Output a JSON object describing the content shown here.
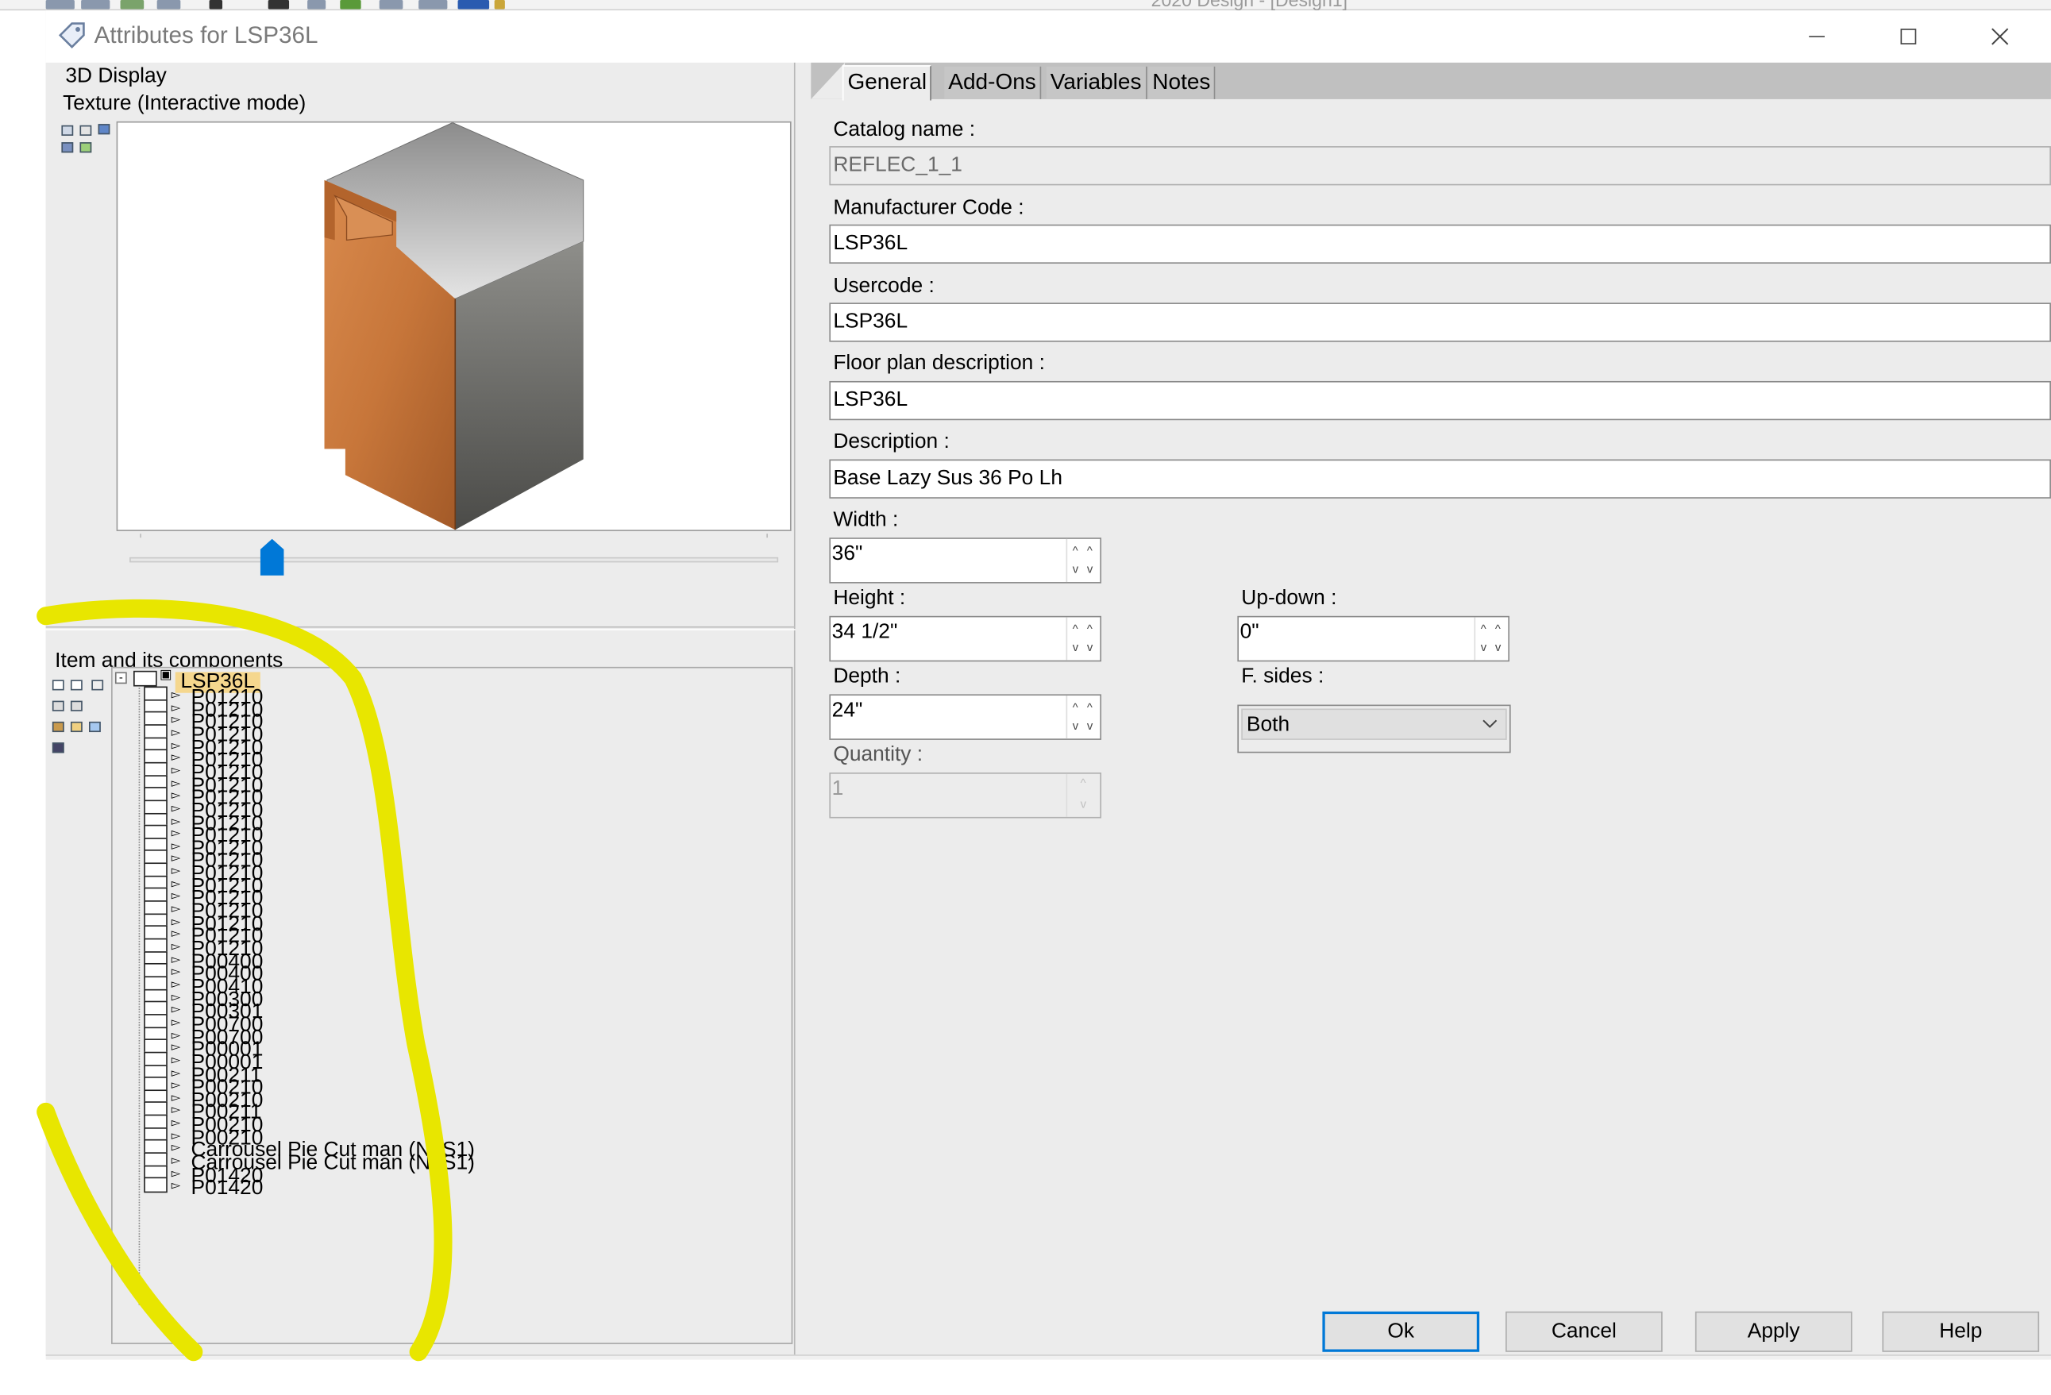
{
  "background_app": {
    "title": "2020 Design - [Design1]"
  },
  "window": {
    "title": "Attributes for LSP36L",
    "minimize": "—",
    "maximize": "☐",
    "close": "✕"
  },
  "left": {
    "display_label": "3D Display",
    "texture_label": "Texture (Interactive mode)",
    "components_label": "Item and its components",
    "tree": {
      "root": "LSP36L",
      "items": [
        "P01210",
        "P01210",
        "P01210",
        "P01210",
        "P01210",
        "P01210",
        "P01210",
        "P01210",
        "P01210",
        "P01210",
        "P01210",
        "P01210",
        "P01210",
        "P01210",
        "P01210",
        "P01210",
        "P01210",
        "P01210",
        "P01210",
        "P01210",
        "P01210",
        "P00400",
        "P00400",
        "P00410",
        "P00300",
        "P00301",
        "P00700",
        "P00700",
        "P00001",
        "P00001",
        "P00211",
        "P00210",
        "P00210",
        "P00211",
        "P00210",
        "P00210",
        "Carrousel Pie Cut man (NLS1)",
        "Carrousel Pie Cut man (NLS1)",
        "P01420",
        "P01420"
      ]
    }
  },
  "tabs": [
    "General",
    "Add-Ons",
    "Variables",
    "Notes"
  ],
  "form": {
    "catalog_name": {
      "label": "Catalog name :",
      "value": "REFLEC_1_1"
    },
    "manufacturer_code": {
      "label": "Manufacturer Code :",
      "value": "LSP36L"
    },
    "usercode": {
      "label": "Usercode :",
      "value": "LSP36L"
    },
    "floor_plan_description": {
      "label": "Floor plan description :",
      "value": "LSP36L"
    },
    "description": {
      "label": "Description :",
      "value": "Base Lazy Sus 36 Po Lh"
    },
    "width": {
      "label": "Width :",
      "value": "36\""
    },
    "height": {
      "label": "Height :",
      "value": "34 1/2\""
    },
    "depth": {
      "label": "Depth :",
      "value": "24\""
    },
    "quantity": {
      "label": "Quantity :",
      "value": "1"
    },
    "up_down": {
      "label": "Up-down :",
      "value": "0\""
    },
    "f_sides": {
      "label": "F. sides :",
      "value": "Both"
    }
  },
  "buttons": {
    "ok": "Ok",
    "cancel": "Cancel",
    "apply": "Apply",
    "help": "Help"
  },
  "colors": {
    "accent": "#0078d7",
    "highlight": "#e8e600",
    "door": "#c9773a",
    "root_highlight": "#f5d78e"
  },
  "texture_slider": {
    "level": 0.21
  }
}
